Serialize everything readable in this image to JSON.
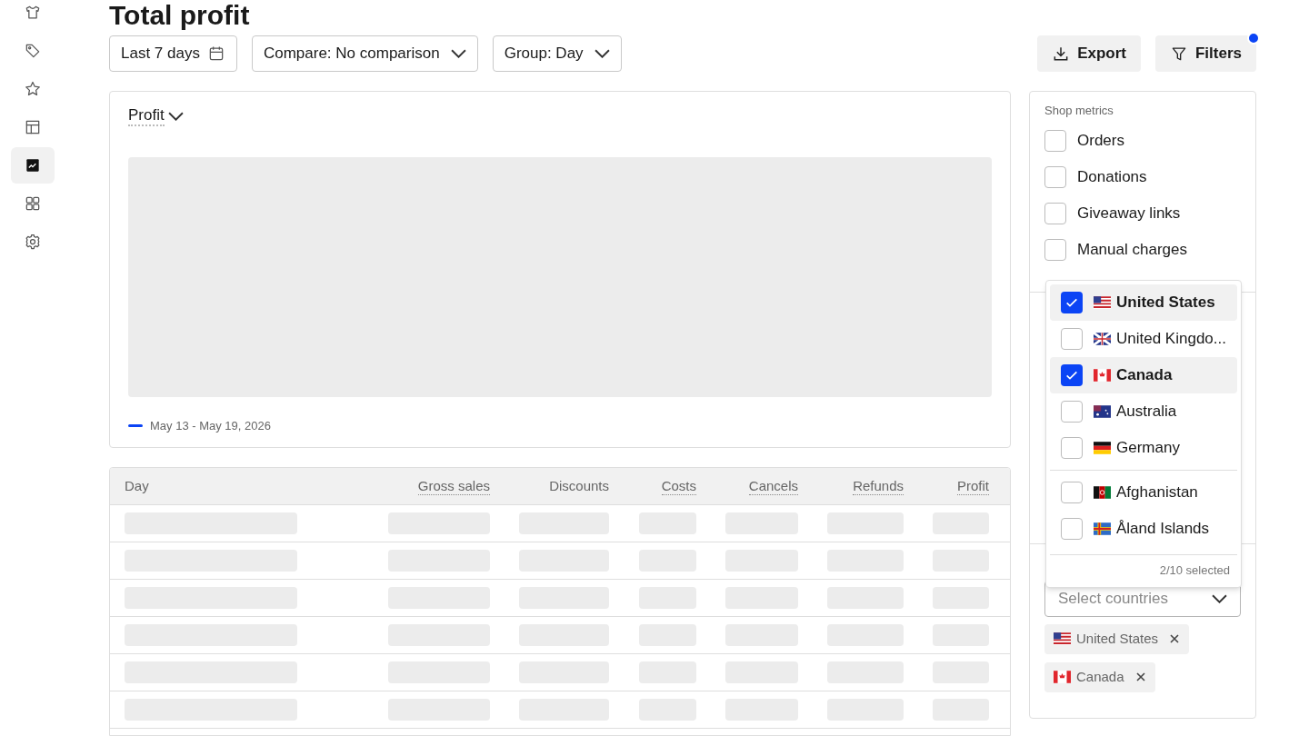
{
  "sidebar": {
    "items": [
      {
        "selected": false
      },
      {
        "selected": false
      },
      {
        "selected": false
      },
      {
        "selected": false
      },
      {
        "selected": true
      },
      {
        "selected": false
      },
      {
        "selected": false
      }
    ]
  },
  "page_title": "Total profit",
  "toolbar": {
    "date_range": "Last 7 days",
    "compare": "Compare: No comparison",
    "group": "Group: Day",
    "export": "Export",
    "filters": {
      "label": "Filters",
      "active": true
    }
  },
  "chart": {
    "metric": "Profit",
    "loading": true,
    "legend": {
      "label": "May 13 - May 19, 2026",
      "color": "#0b44f5"
    }
  },
  "table": {
    "loading": true,
    "columns": [
      {
        "label": "Day",
        "underlined": false
      },
      {
        "label": "Gross sales",
        "underlined": true
      },
      {
        "label": "Discounts",
        "underlined": false
      },
      {
        "label": "Costs",
        "underlined": true
      },
      {
        "label": "Cancels",
        "underlined": true
      },
      {
        "label": "Refunds",
        "underlined": true
      },
      {
        "label": "Profit",
        "underlined": true
      }
    ]
  },
  "filters_panel": {
    "section_title": "Shop metrics",
    "metrics": [
      {
        "label": "Orders",
        "checked": false
      },
      {
        "label": "Donations",
        "checked": false
      },
      {
        "label": "Giveaway links",
        "checked": false
      },
      {
        "label": "Manual charges",
        "checked": false
      }
    ],
    "country_dropdown": {
      "options": [
        {
          "label": "United States",
          "checked": true
        },
        {
          "label": "United Kingdo...",
          "checked": false
        },
        {
          "label": "Canada",
          "checked": true
        },
        {
          "label": "Australia",
          "checked": false
        },
        {
          "label": "Germany",
          "checked": false,
          "divider_after": true
        },
        {
          "label": "Afghanistan",
          "checked": false
        },
        {
          "label": "Åland Islands",
          "checked": false
        }
      ],
      "footer": "2/10 selected"
    },
    "country_select": {
      "placeholder": "Select countries"
    },
    "chips": [
      {
        "label": "United States"
      },
      {
        "label": "Canada"
      }
    ]
  }
}
